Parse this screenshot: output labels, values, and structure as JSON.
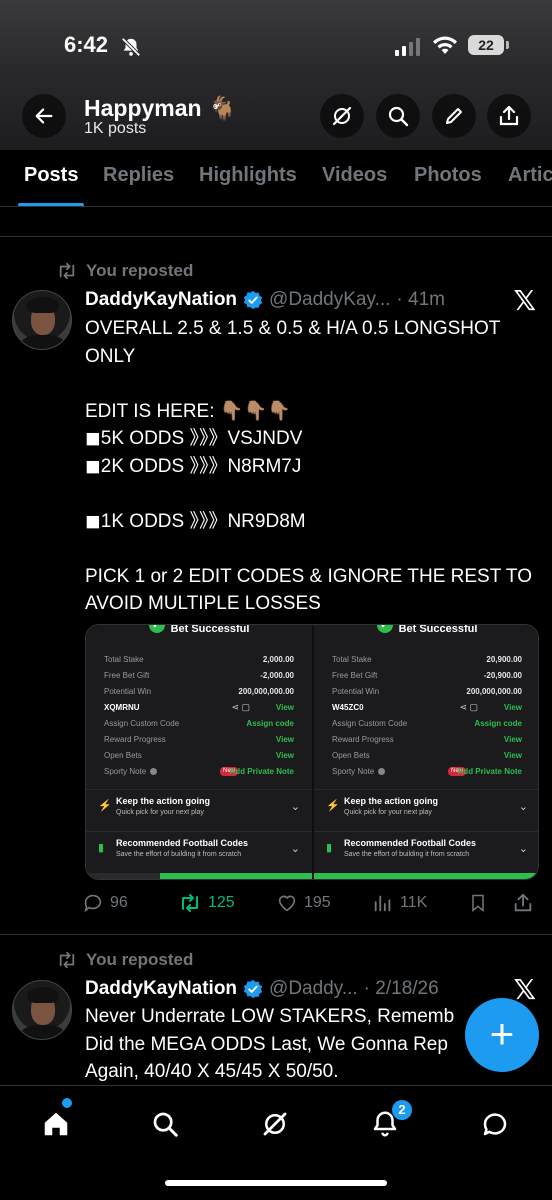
{
  "status": {
    "time": "6:42",
    "battery": "22"
  },
  "header": {
    "name": "Happyman 🐐",
    "posts": "1K posts"
  },
  "tabs": [
    "Posts",
    "Replies",
    "Highlights",
    "Videos",
    "Photos",
    "Artic"
  ],
  "tweet1": {
    "repost_label": "You reposted",
    "name": "DaddyKayNation",
    "handle": "@DaddyKay...",
    "time": "· 41m",
    "text": "OVERALL 2.5 & 1.5 & 0.5 & H/A 0.5 LONGSHOT ONLY\n\nEDIT IS HERE: 👇🏽👇🏽👇🏽\n◼5K ODDS 》》》VSJNDV\n◼2K ODDS 》》》N8RM7J\n\n◼1K ODDS 》》》NR9D8M\n\nPICK 1 or 2 EDIT CODES & IGNORE THE REST TO AVOID MULTIPLE LOSSES",
    "replies": "96",
    "reposts": "125",
    "likes": "195",
    "views": "11K"
  },
  "bet_cards": [
    {
      "title": "Bet Successful",
      "total_stake_label": "Total Stake",
      "total_stake": "2,000.00",
      "free_bet_label": "Free Bet Gift",
      "free_bet": "-2,000.00",
      "potential_win_label": "Potential Win",
      "potential_win": "200,000,000.00",
      "code": "XQMRNU",
      "view": "View",
      "assign_label": "Assign Custom Code",
      "assign_action": "Assign code",
      "reward_label": "Reward Progress",
      "reward_action": "View",
      "open_label": "Open Bets",
      "open_action": "View",
      "note_label": "Sporty Note",
      "new_badge": "New",
      "note_action": "Add Private Note",
      "promo1_title": "Keep the action going",
      "promo1_sub": "Quick pick for your next play",
      "promo2_title": "Recommended Football Codes",
      "promo2_sub": "Save the effort of building it from scratch"
    },
    {
      "title": "Bet Successful",
      "total_stake_label": "Total Stake",
      "total_stake": "20,900.00",
      "free_bet_label": "Free Bet Gift",
      "free_bet": "-20,900.00",
      "potential_win_label": "Potential Win",
      "potential_win": "200,000,000.00",
      "code": "W45ZC0",
      "view": "View",
      "assign_label": "Assign Custom Code",
      "assign_action": "Assign code",
      "reward_label": "Reward Progress",
      "reward_action": "View",
      "open_label": "Open Bets",
      "open_action": "View",
      "note_label": "Sporty Note",
      "new_badge": "New",
      "note_action": "Add Private Note",
      "promo1_title": "Keep the action going",
      "promo1_sub": "Quick pick for your next play",
      "promo2_title": "Recommended Football Codes",
      "promo2_sub": "Save the effort of building it from scratch"
    }
  ],
  "tweet2": {
    "repost_label": "You reposted",
    "name": "DaddyKayNation",
    "handle": "@Daddy...",
    "time": "· 2/18/26",
    "text": "Never Underrate LOW STAKERS, Rememb\nDid the MEGA ODDS Last, We Gonna Rep\nAgain, 40/40 X 45/45 X 50/50."
  },
  "nav": {
    "notifications_badge": "2"
  },
  "colors": {
    "accent": "#1d9bf0",
    "repost_green": "#00ba7c",
    "bet_green": "#2dbe4e"
  }
}
